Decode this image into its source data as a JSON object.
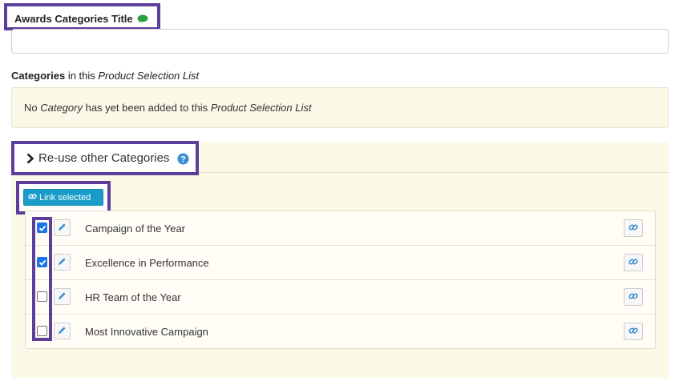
{
  "awards_title": {
    "label": "Awards Categories Title",
    "icon": "chat-bubble-icon",
    "input_value": ""
  },
  "categories_heading": {
    "bold": "Categories",
    "middle": " in this ",
    "italic": "Product Selection List"
  },
  "empty_notice": {
    "part1": "No ",
    "italic1": "Category",
    "part2": " has yet been added to this ",
    "italic2": "Product Selection List"
  },
  "reuse": {
    "toggle_icon": "chevron-right-icon",
    "label": "Re-use other Categories",
    "help_icon": "question-circle-icon",
    "link_selected_label": "Link selected"
  },
  "categories": [
    {
      "name": "Campaign of the Year",
      "checked": true
    },
    {
      "name": "Excellence in Performance",
      "checked": true
    },
    {
      "name": "HR Team of the Year",
      "checked": false
    },
    {
      "name": "Most Innovative Campaign",
      "checked": false
    }
  ],
  "colors": {
    "highlight": "#5b3f9b",
    "accent": "#1a9cc9",
    "panel_bg": "#fcf8e8",
    "chat_green": "#2e9e3e",
    "checkbox_blue": "#1a73e8"
  }
}
